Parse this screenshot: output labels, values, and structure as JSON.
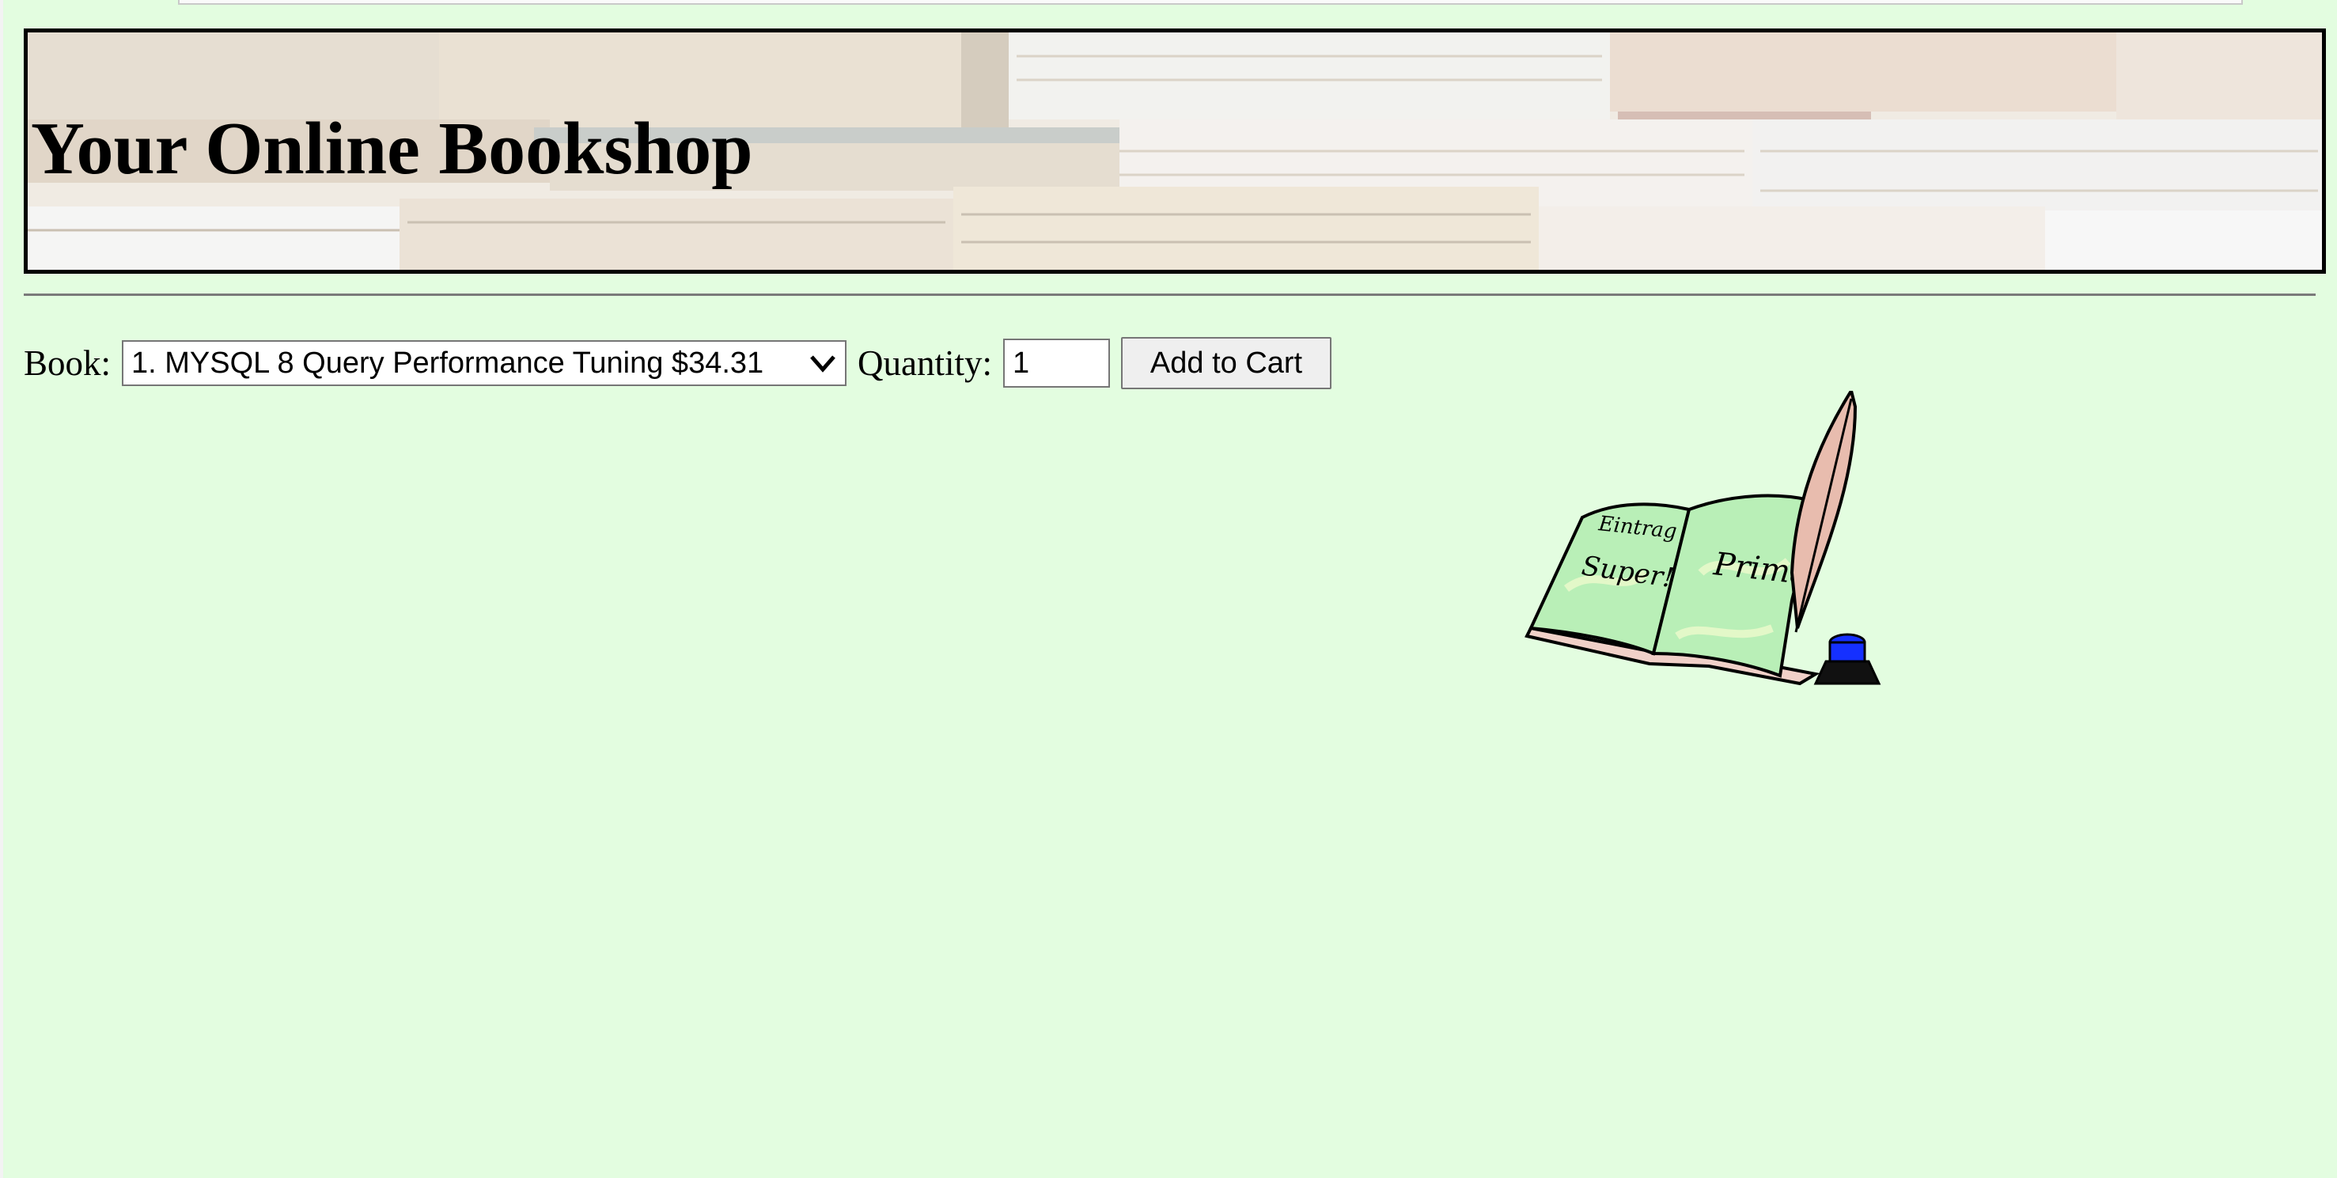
{
  "header": {
    "title": "Your Online Bookshop"
  },
  "order_form": {
    "book_label": "Book:",
    "book_selected": "1. MYSQL 8 Query Performance Tuning $34.31",
    "quantity_label": "Quantity:",
    "quantity_value": "1",
    "add_button_label": "Add to Cart"
  },
  "illustration": {
    "left_page_text_top": "Eintrag",
    "left_page_text_bottom": "Super!",
    "right_page_text": "Prima!"
  },
  "colors": {
    "page_background": "#e3fde0",
    "banner_border": "#000000",
    "book_page_green": "#b9efb7",
    "ink_blue": "#1530ff"
  }
}
